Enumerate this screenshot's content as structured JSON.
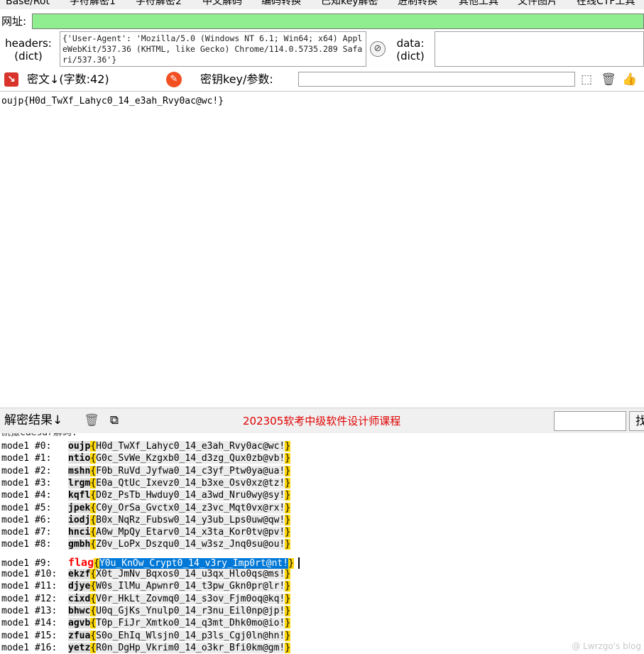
{
  "menu": [
    "Base/Rot",
    "字符解密1",
    "字符解密2",
    "中文解码",
    "编码转换",
    "已知key解密",
    "进制转换",
    "其他工具",
    "文件图片",
    "在线CTF工具"
  ],
  "url": {
    "label": "网址:",
    "value": ""
  },
  "headers": {
    "label": "headers:\n(dict)",
    "value": "{'User-Agent': 'Mozilla/5.0 (Windows NT 6.1; Win64; x64) AppleWebKit/537.36 (KHTML, like Gecko) Chrome/114.0.5735.289 Safari/537.36'}"
  },
  "data_field": {
    "label": "data:\n(dict)",
    "value": ""
  },
  "cipher_toolbar": {
    "label": "密文↓(字数:42)",
    "key_label": "密钥key/参数:",
    "key_value": ""
  },
  "ciphertext": "oujp{H0d_TwXf_Lahyc0_14_e3ah_Rvy0ac@wc!}",
  "result_toolbar": {
    "label": "解密结果↓",
    "course_link": "202305软考中级软件设计师课程",
    "small_input": "",
    "cut_label": "找"
  },
  "results": {
    "heading": "凯撒Caesar解码:",
    "rows": [
      {
        "mode": "mode1 #0:",
        "prefix": "oujp",
        "body": "H0d_TwXf_Lahyc0_14_e3ah_Rvy0ac@wc!"
      },
      {
        "mode": "mode1 #1:",
        "prefix": "ntio",
        "body": "G0c_SvWe_Kzgxb0_14_d3zg_Qux0zb@vb!"
      },
      {
        "mode": "mode1 #2:",
        "prefix": "mshn",
        "body": "F0b_RuVd_Jyfwa0_14_c3yf_Ptw0ya@ua!"
      },
      {
        "mode": "mode1 #3:",
        "prefix": "lrgm",
        "body": "E0a_QtUc_Ixevz0_14_b3xe_Osv0xz@tz!"
      },
      {
        "mode": "mode1 #4:",
        "prefix": "kqfl",
        "body": "D0z_PsTb_Hwduy0_14_a3wd_Nru0wy@sy!"
      },
      {
        "mode": "mode1 #5:",
        "prefix": "jpek",
        "body": "C0y_OrSa_Gvctx0_14_z3vc_Mqt0vx@rx!"
      },
      {
        "mode": "mode1 #6:",
        "prefix": "iodj",
        "body": "B0x_NqRz_Fubsw0_14_y3ub_Lps0uw@qw!"
      },
      {
        "mode": "mode1 #7:",
        "prefix": "hnci",
        "body": "A0w_MpQy_Etarv0_14_x3ta_Kor0tv@pv!"
      },
      {
        "mode": "mode1 #8:",
        "prefix": "gmbh",
        "body": "Z0v_LoPx_Dszqu0_14_w3sz_Jnq0su@ou!"
      },
      {
        "mode": "mode1 #9:",
        "prefix": "flag",
        "body": "Y0u_KnOw_Crypt0_14_v3ry_Imp0rt@nt!",
        "highlight": true
      },
      {
        "mode": "mode1 #10:",
        "prefix": "ekzf",
        "body": "X0t_JmNv_Bqxos0_14_u3qx_Hlo0qs@ms!"
      },
      {
        "mode": "mode1 #11:",
        "prefix": "djye",
        "body": "W0s_IlMu_Apwnr0_14_t3pw_Gkn0pr@lr!"
      },
      {
        "mode": "mode1 #12:",
        "prefix": "cixd",
        "body": "V0r_HkLt_Zovmq0_14_s3ov_Fjm0oq@kq!"
      },
      {
        "mode": "mode1 #13:",
        "prefix": "bhwc",
        "body": "U0q_GjKs_Ynulp0_14_r3nu_Eil0np@jp!"
      },
      {
        "mode": "mode1 #14:",
        "prefix": "agvb",
        "body": "T0p_FiJr_Xmtko0_14_q3mt_Dhk0mo@io!"
      },
      {
        "mode": "mode1 #15:",
        "prefix": "zfua",
        "body": "S0o_EhIq_Wlsjn0_14_p3ls_Cgj0ln@hn!"
      },
      {
        "mode": "mode1 #16:",
        "prefix": "yetz",
        "body": "R0n_DgHp_Vkrim0_14_o3kr_Bfi0km@gm!"
      }
    ]
  },
  "watermark": "@ Lwrzgo's blog"
}
